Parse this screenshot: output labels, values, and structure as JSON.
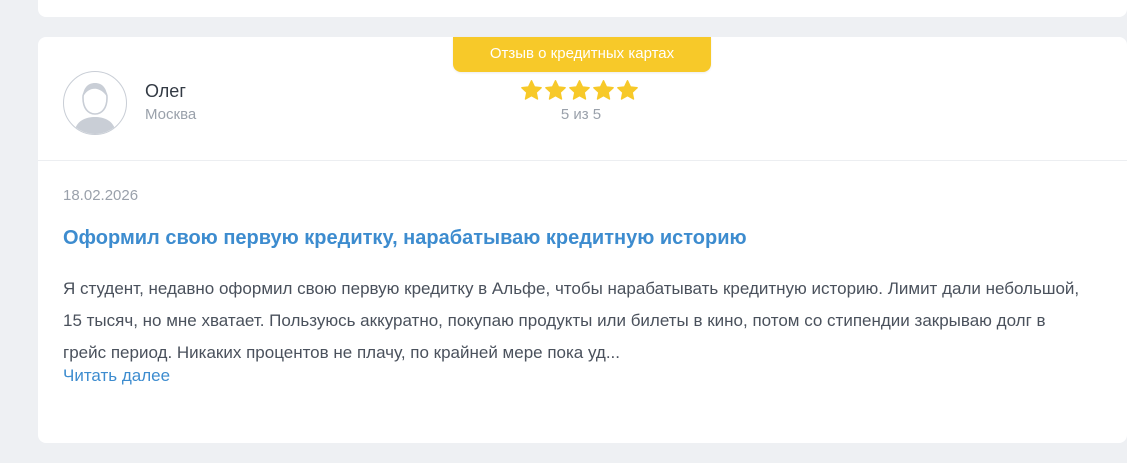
{
  "review": {
    "category": "Отзыв о кредитных картах",
    "author": {
      "name": "Олег",
      "city": "Москва"
    },
    "rating": {
      "value": 5,
      "max": 5,
      "label": "5 из 5",
      "star_color": "#f7c929"
    },
    "date": "18.02.2026",
    "title": "Оформил свою первую кредитку, нарабатываю кредитную историю",
    "text": "Я студент, недавно оформил свою первую кредитку в Альфе, чтобы нарабатывать кредитную историю. Лимит дали небольшой, 15 тысяч, но мне хватает. Пользуюсь аккуратно, покупаю продукты или билеты в кино, потом со стипендии закрываю долг в грейс период. Никаких процентов не плачу, по крайней мере пока уд...",
    "read_more": "Читать далее"
  },
  "colors": {
    "accent": "#3d8ccf",
    "badge": "#f7c929",
    "background": "#eef0f3"
  },
  "icons": {
    "avatar": "user-avatar-icon",
    "star": "star-icon"
  }
}
